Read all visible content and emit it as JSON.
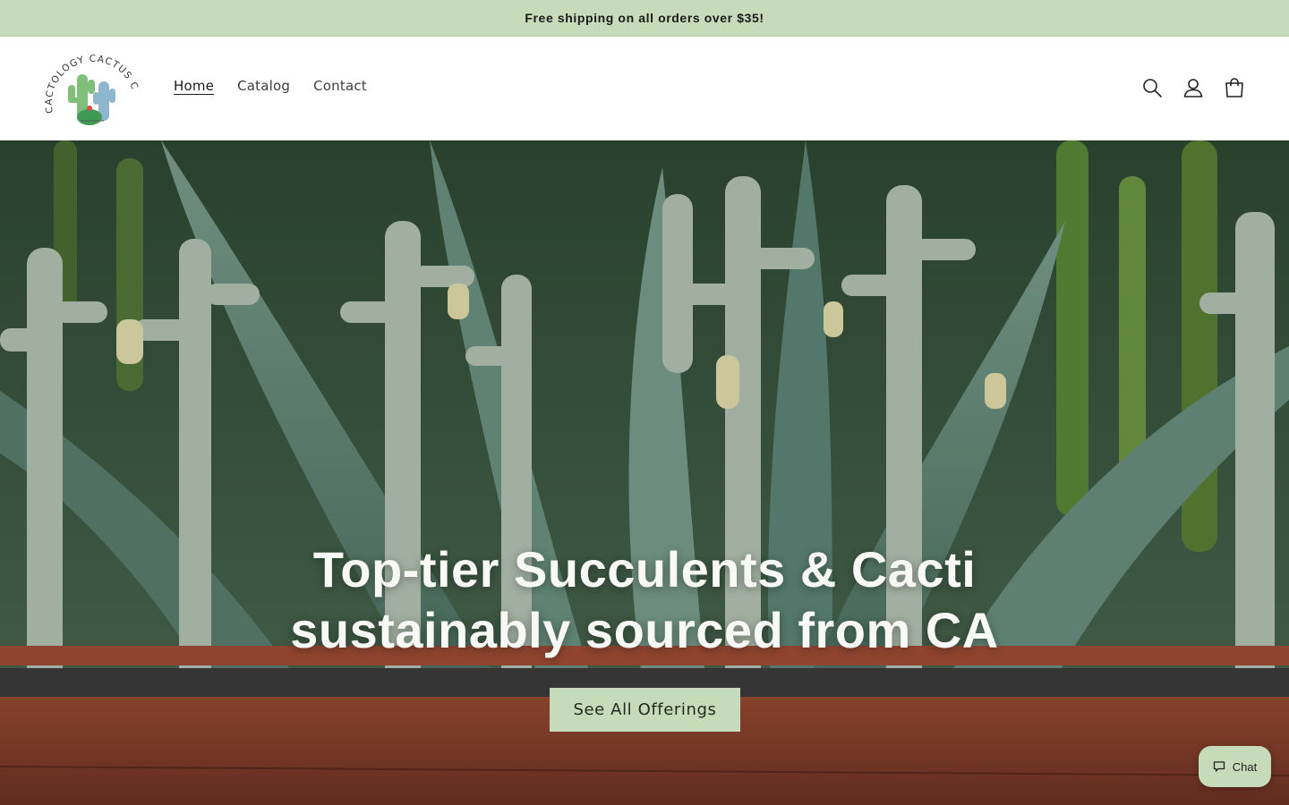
{
  "announcement": {
    "text": "Free shipping on all orders over $35!"
  },
  "header": {
    "logo": {
      "text": "CACTOLOGY CACTUS CO."
    },
    "nav": [
      {
        "label": "Home",
        "active": true
      },
      {
        "label": "Catalog",
        "active": false
      },
      {
        "label": "Contact",
        "active": false
      }
    ],
    "icons": [
      "search-icon",
      "account-icon",
      "cart-icon"
    ]
  },
  "hero": {
    "title_line1": "Top-tier Succulents & Cacti",
    "title_line2": "sustainably sourced from CA",
    "button_label": "See All Offerings"
  },
  "chat": {
    "label": "Chat",
    "icon": "chat-bubble-icon"
  },
  "colors": {
    "accent": "#c6dbba",
    "text_dark": "#1a1a1a"
  }
}
